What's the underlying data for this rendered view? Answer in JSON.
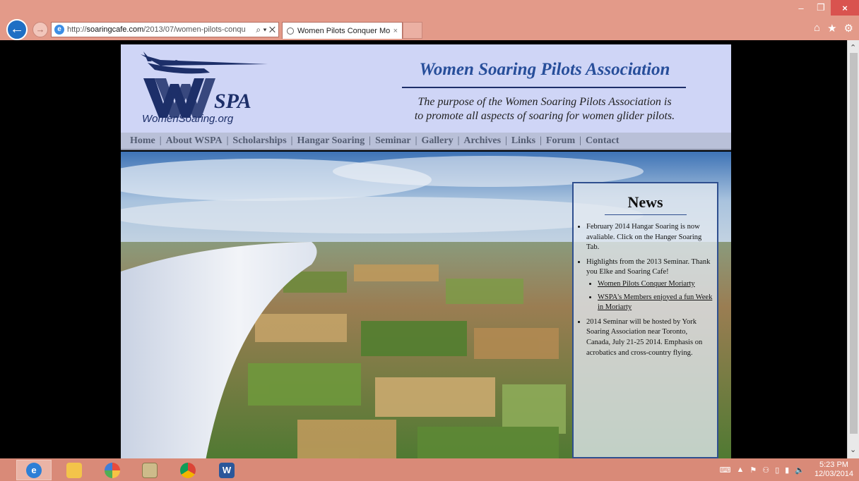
{
  "browser": {
    "address_url_prefix": "http://",
    "address_url_host": "soaringcafe.com",
    "address_url_path": "/2013/07/women-pilots-conqu",
    "address_controls": "⌕ ▾ ✕",
    "tab_title": "Women Pilots Conquer Mo...",
    "tab_close": "×",
    "window_controls": [
      "–",
      "❐",
      "×"
    ],
    "toolbar_icons": [
      "home-icon",
      "favorites-star-icon",
      "settings-gear-icon"
    ]
  },
  "header": {
    "logo_text": "WomenSoaring.org",
    "logo_letters": "SPA",
    "title": "Women Soaring Pilots Association",
    "tagline_line1": "The purpose of the Women Soaring Pilots Association is",
    "tagline_line2": "to promote all aspects of soaring for women glider pilots."
  },
  "nav": {
    "items": [
      "Home",
      "About WSPA",
      "Scholarships",
      "Hangar Soaring",
      "Seminar",
      "Gallery",
      "Archives",
      "Links",
      "Forum",
      "Contact"
    ],
    "separator": "|"
  },
  "news": {
    "heading": "News",
    "item1": "February 2014 Hangar Soaring is now avaliable.  Click on the Hanger Soaring Tab.",
    "item2": "Highlights from the 2013 Seminar. Thank you Elke and Soaring Cafe!",
    "item2_links": [
      "Women Pilots Conquer Moriarty",
      "WSPA's Members enjoyed a fun Week in Moriarty"
    ],
    "item3": "2014 Seminar will be hosted by York Soaring Association near Toronto, Canada, July 21-25 2014. Emphasis on acrobatics and cross-country flying."
  },
  "taskbar": {
    "apps": [
      "internet-explorer",
      "file-explorer",
      "picasa",
      "photo-viewer",
      "chrome",
      "word"
    ],
    "time": "5:23 PM",
    "date": "12/03/2014"
  },
  "colors": {
    "chrome": "#e39a89",
    "header_bg": "#cfd5f6",
    "title_blue": "#274e9a",
    "nav_bg": "#b9c0d8"
  }
}
